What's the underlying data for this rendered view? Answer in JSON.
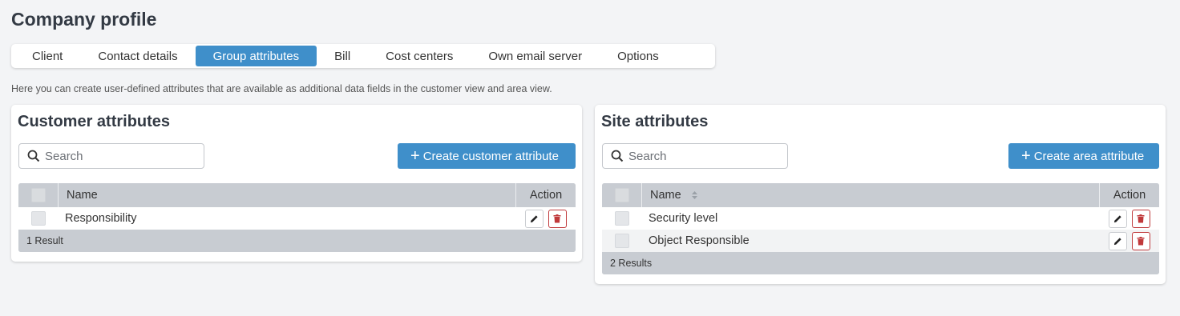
{
  "page": {
    "title": "Company profile",
    "description": "Here you can create user-defined attributes that are available as additional data fields in the customer view and area view."
  },
  "tabs": [
    {
      "label": "Client",
      "active": false
    },
    {
      "label": "Contact details",
      "active": false
    },
    {
      "label": "Group attributes",
      "active": true
    },
    {
      "label": "Bill",
      "active": false
    },
    {
      "label": "Cost centers",
      "active": false
    },
    {
      "label": "Own email server",
      "active": false
    },
    {
      "label": "Options",
      "active": false
    }
  ],
  "customer": {
    "title": "Customer attributes",
    "search_placeholder": "Search",
    "create_label": "Create customer attribute",
    "columns": {
      "name": "Name",
      "action": "Action"
    },
    "rows": [
      {
        "name": "Responsibility"
      }
    ],
    "footer": "1 Result"
  },
  "site": {
    "title": "Site attributes",
    "search_placeholder": "Search",
    "create_label": "Create area attribute",
    "columns": {
      "name": "Name",
      "action": "Action"
    },
    "rows": [
      {
        "name": "Security level"
      },
      {
        "name": "Object Responsible"
      }
    ],
    "footer": "2 Results"
  },
  "colors": {
    "accent": "#3f8fca",
    "danger": "#c0393b",
    "grid_header": "#c8ccd2",
    "background": "#f3f4f6"
  },
  "icons": {
    "search": "search-icon",
    "plus": "plus-icon",
    "edit": "pencil-icon",
    "delete": "trash-icon",
    "sort": "sort-icon"
  }
}
